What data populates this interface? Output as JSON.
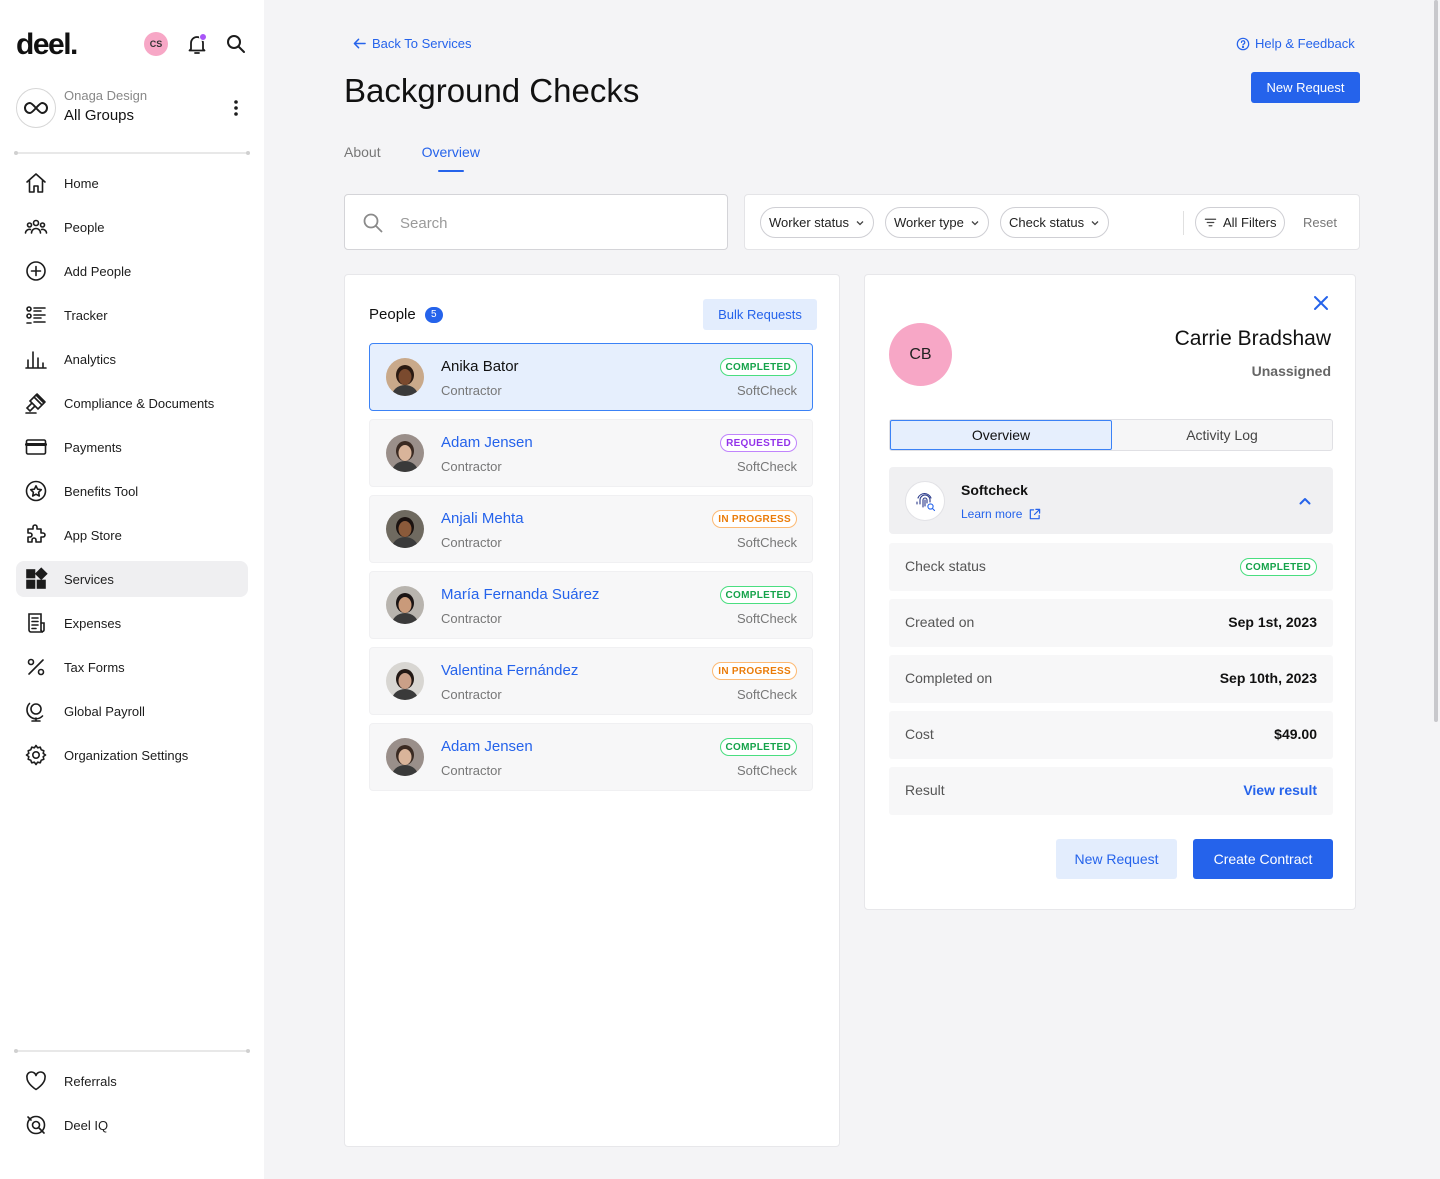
{
  "app": {
    "logo": "deel.",
    "user_initials": "CS",
    "org_subtitle": "Onaga Design",
    "org_name": "All Groups"
  },
  "sidebar": {
    "items": [
      {
        "label": "Home",
        "icon": "home-icon"
      },
      {
        "label": "People",
        "icon": "people-icon"
      },
      {
        "label": "Add People",
        "icon": "add-circle-icon"
      },
      {
        "label": "Tracker",
        "icon": "tracker-list-icon"
      },
      {
        "label": "Analytics",
        "icon": "bar-chart-icon"
      },
      {
        "label": "Compliance & Documents",
        "icon": "gavel-icon"
      },
      {
        "label": "Payments",
        "icon": "credit-card-icon"
      },
      {
        "label": "Benefits Tool",
        "icon": "star-badge-icon"
      },
      {
        "label": "App Store",
        "icon": "puzzle-icon"
      },
      {
        "label": "Services",
        "icon": "grid-icon",
        "active": true
      },
      {
        "label": "Expenses",
        "icon": "receipt-icon"
      },
      {
        "label": "Tax Forms",
        "icon": "percent-icon"
      },
      {
        "label": "Global Payroll",
        "icon": "globe-stand-icon"
      },
      {
        "label": "Organization Settings",
        "icon": "gear-icon"
      }
    ],
    "bottom_items": [
      {
        "label": "Referrals",
        "icon": "heart-icon"
      },
      {
        "label": "Deel IQ",
        "icon": "deel-iq-icon"
      }
    ]
  },
  "header": {
    "back_label": "Back To Services",
    "help_label": "Help & Feedback",
    "title": "Background Checks",
    "new_request_label": "New Request",
    "tabs": [
      {
        "label": "About",
        "active": false
      },
      {
        "label": "Overview",
        "active": true
      }
    ]
  },
  "search": {
    "placeholder": "Search",
    "value": ""
  },
  "filters": {
    "chips": [
      "Worker status",
      "Worker type",
      "Check status"
    ],
    "all_filters_label": "All Filters",
    "reset_label": "Reset"
  },
  "people": {
    "title": "People",
    "count": "5",
    "bulk_label": "Bulk Requests",
    "list": [
      {
        "name": "Anika Bator",
        "role": "Contractor",
        "vendor": "SoftCheck",
        "status": "COMPLETED",
        "status_key": "completed",
        "selected": true,
        "skin": "#7a4a2e",
        "hair": "#2a1a12",
        "bg": "#c9a98a"
      },
      {
        "name": "Adam Jensen",
        "role": "Contractor",
        "vendor": "SoftCheck",
        "status": "REQUESTED",
        "status_key": "requested",
        "selected": false,
        "skin": "#d9b49a",
        "hair": "#3a2a22",
        "bg": "#9a8f8a"
      },
      {
        "name": "Anjali Mehta",
        "role": "Contractor",
        "vendor": "SoftCheck",
        "status": "IN PROGRESS",
        "status_key": "in-progress",
        "selected": false,
        "skin": "#8a5a3a",
        "hair": "#1a1210",
        "bg": "#6f6a60"
      },
      {
        "name": "María Fernanda Suárez",
        "role": "Contractor",
        "vendor": "SoftCheck",
        "status": "COMPLETED",
        "status_key": "completed",
        "selected": false,
        "skin": "#c99a7a",
        "hair": "#1a1414",
        "bg": "#b8b4ae"
      },
      {
        "name": "Valentina Fernández",
        "role": "Contractor",
        "vendor": "SoftCheck",
        "status": "IN PROGRESS",
        "status_key": "in-progress",
        "selected": false,
        "skin": "#caa088",
        "hair": "#221814",
        "bg": "#d8d6d2"
      },
      {
        "name": "Adam Jensen",
        "role": "Contractor",
        "vendor": "SoftCheck",
        "status": "COMPLETED",
        "status_key": "completed",
        "selected": false,
        "skin": "#d9b49a",
        "hair": "#3a2a22",
        "bg": "#9a8f8a"
      }
    ]
  },
  "detail": {
    "initials": "CB",
    "name": "Carrie Bradshaw",
    "assignment": "Unassigned",
    "tabs": [
      {
        "label": "Overview",
        "active": true
      },
      {
        "label": "Activity Log",
        "active": false
      }
    ],
    "vendor": {
      "name": "Softcheck",
      "learn_more": "Learn more"
    },
    "rows": {
      "check_status_label": "Check status",
      "check_status_value": "COMPLETED",
      "created_label": "Created on",
      "created_value": "Sep 1st, 2023",
      "completed_label": "Completed on",
      "completed_value": "Sep 10th, 2023",
      "cost_label": "Cost",
      "cost_value": "$49.00",
      "result_label": "Result",
      "result_value": "View result"
    },
    "new_request_label": "New Request",
    "create_contract_label": "Create Contract"
  },
  "colors": {
    "accent": "#2563eb",
    "completed": "#15a34a",
    "requested": "#9333ea",
    "in_progress": "#ea7c0a",
    "avatar_pink": "#f7a7c6"
  }
}
